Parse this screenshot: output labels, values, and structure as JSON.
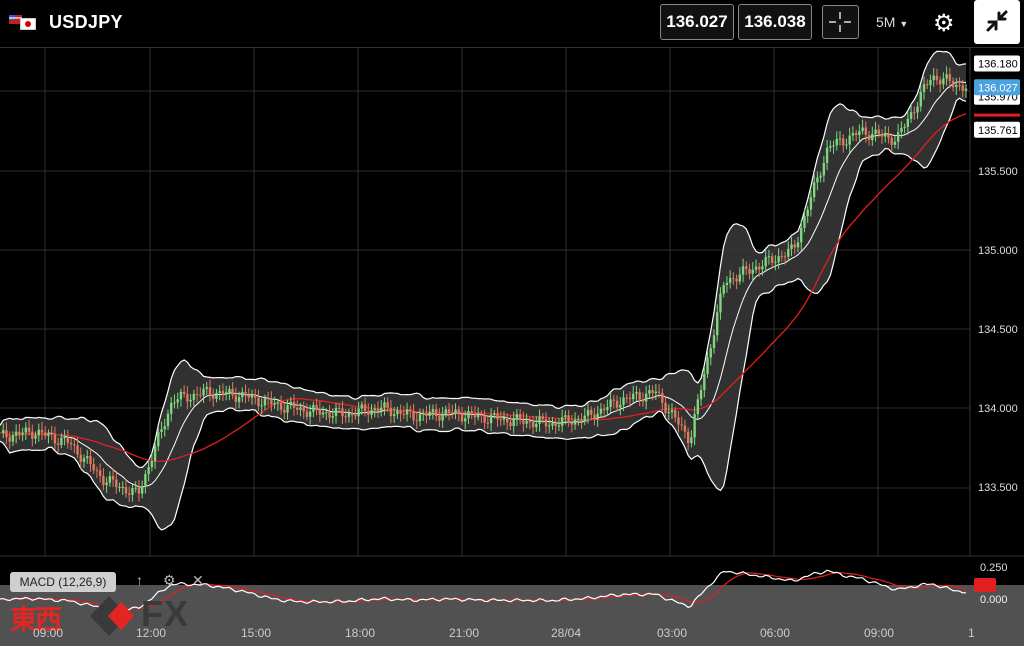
{
  "header": {
    "symbol": "USDJPY",
    "bid": "136.027",
    "ask": "136.038",
    "timeframe": "5M",
    "flags": [
      "us-flag-icon",
      "jp-flag-icon"
    ]
  },
  "price_axis": {
    "labels": [
      "136.180",
      "136.027",
      "135.970",
      "135.761",
      "135.500",
      "135.000",
      "134.500",
      "134.000",
      "133.500"
    ],
    "current_price": "136.027",
    "current_price_color": "#4aa3df",
    "ma_price_color": "#e02020"
  },
  "time_axis": {
    "labels": [
      "09:00",
      "12:00",
      "15:00",
      "18:00",
      "21:00",
      "28/04",
      "03:00",
      "06:00",
      "09:00",
      "1"
    ]
  },
  "macd": {
    "label": "MACD (12,26,9)",
    "axis_labels": [
      "0.250",
      "0.000"
    ],
    "icons": [
      "up-arrow-icon",
      "gear-icon",
      "close-icon"
    ]
  },
  "watermark": {
    "kanji": "東西",
    "fx": "FX"
  },
  "chart_data": {
    "type": "candlestick",
    "instrument": "USDJPY",
    "interval": "5M",
    "ylim": [
      133.25,
      136.3
    ],
    "indicators": [
      "Bollinger Bands",
      "Moving Average",
      "MACD (12,26,9)"
    ],
    "price_path": [
      {
        "t": "09:00",
        "close": 133.82
      },
      {
        "t": "10:00",
        "close": 133.85
      },
      {
        "t": "11:00",
        "close": 133.78
      },
      {
        "t": "12:00",
        "close": 133.55
      },
      {
        "t": "13:00",
        "close": 133.45
      },
      {
        "t": "14:00",
        "close": 134.05
      },
      {
        "t": "15:00",
        "close": 134.1
      },
      {
        "t": "16:00",
        "close": 134.08
      },
      {
        "t": "17:00",
        "close": 134.02
      },
      {
        "t": "18:00",
        "close": 133.98
      },
      {
        "t": "19:00",
        "close": 133.96
      },
      {
        "t": "20:00",
        "close": 134.0
      },
      {
        "t": "21:00",
        "close": 133.95
      },
      {
        "t": "22:00",
        "close": 133.97
      },
      {
        "t": "23:00",
        "close": 133.94
      },
      {
        "t": "28/04",
        "close": 133.92
      },
      {
        "t": "01:00",
        "close": 133.9
      },
      {
        "t": "02:00",
        "close": 133.94
      },
      {
        "t": "03:00",
        "close": 134.05
      },
      {
        "t": "04:00",
        "close": 134.1
      },
      {
        "t": "05:00",
        "close": 133.8
      },
      {
        "t": "05:30",
        "close": 134.8
      },
      {
        "t": "06:00",
        "close": 134.9
      },
      {
        "t": "07:00",
        "close": 135.0
      },
      {
        "t": "08:00",
        "close": 135.65
      },
      {
        "t": "08:30",
        "close": 135.75
      },
      {
        "t": "09:00",
        "close": 135.7
      },
      {
        "t": "10:00",
        "close": 136.1
      },
      {
        "t": "10:30",
        "close": 136.027
      }
    ]
  }
}
